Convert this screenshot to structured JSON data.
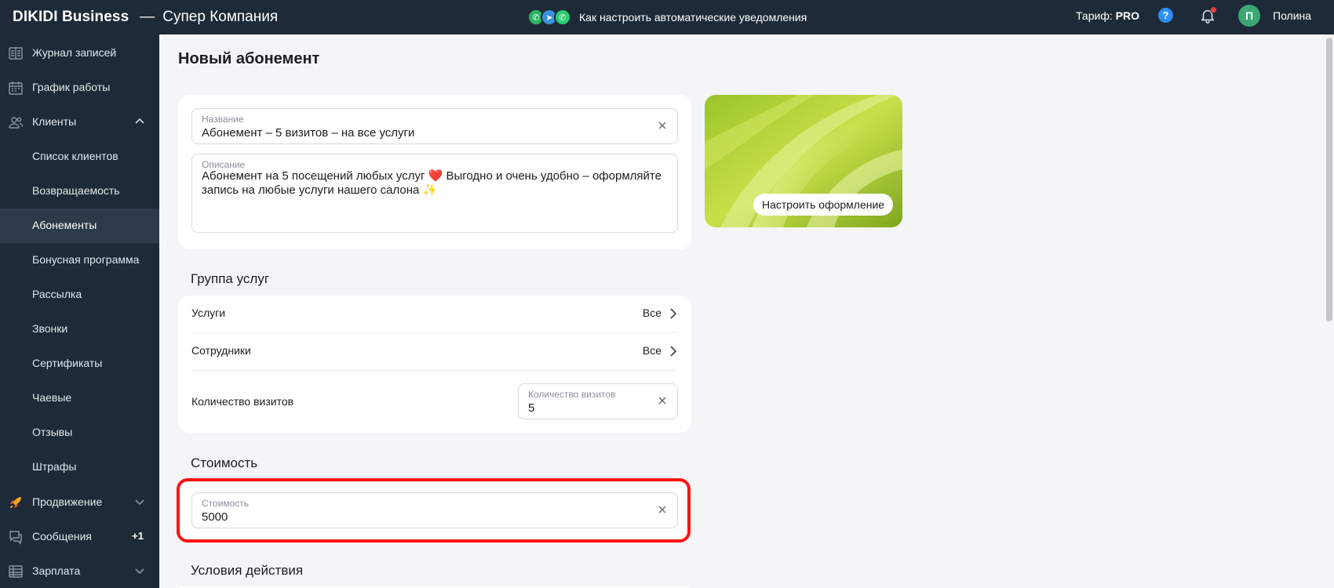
{
  "header": {
    "brand": "DIKIDI Business",
    "separator": "—",
    "company": "Супер Компания",
    "promo_text": "Как настроить автоматические уведомления",
    "promo_icons": [
      "whatsapp-icon",
      "telegram-icon",
      "viber-icon"
    ],
    "tariff_label": "Тариф:",
    "tariff_value": "PRO",
    "help_label": "?",
    "avatar_letter": "П",
    "user_name": "Полина"
  },
  "sidebar": {
    "items": [
      {
        "label": "Журнал записей",
        "icon": "journal-icon"
      },
      {
        "label": "График работы",
        "icon": "calendar-icon"
      },
      {
        "label": "Клиенты",
        "icon": "clients-icon",
        "expanded": true
      },
      {
        "label": "Список клиентов"
      },
      {
        "label": "Возвращаемость"
      },
      {
        "label": "Абонементы",
        "active": true
      },
      {
        "label": "Бонусная программа"
      },
      {
        "label": "Рассылка"
      },
      {
        "label": "Звонки"
      },
      {
        "label": "Сертификаты"
      },
      {
        "label": "Чаевые"
      },
      {
        "label": "Отзывы"
      },
      {
        "label": "Штрафы"
      },
      {
        "label": "Продвижение",
        "icon": "rocket-icon"
      },
      {
        "label": "Сообщения",
        "icon": "messages-icon",
        "badge": "+1"
      },
      {
        "label": "Зарплата",
        "icon": "salary-icon"
      }
    ]
  },
  "main": {
    "title": "Новый абонемент",
    "name_field": {
      "label": "Название",
      "value": "Абонемент – 5 визитов – на все услуги"
    },
    "description_field": {
      "label": "Описание",
      "value": "Абонемент на 5 посещений любых услуг ❤️ Выгодно и очень удобно – оформляйте запись на любые услуги нашего салона ✨"
    },
    "cover_button": "Настроить оформление",
    "group_title": "Группа услуг",
    "services_row": {
      "label": "Услуги",
      "value": "Все"
    },
    "staff_row": {
      "label": "Сотрудники",
      "value": "Все"
    },
    "visits_row": {
      "label": "Количество визитов",
      "field_label": "Количество визитов",
      "field_value": "5"
    },
    "cost_title": "Стоимость",
    "cost_field": {
      "label": "Стоимость",
      "value": "5000"
    },
    "conditions_title": "Условия действия"
  },
  "colors": {
    "sidebar_bg": "#1e2a38",
    "active_item_bg": "#2c3a4a",
    "highlight_border": "#ff1212",
    "avatar_bg": "#3aa870",
    "help_bg": "#2d8ff0"
  }
}
